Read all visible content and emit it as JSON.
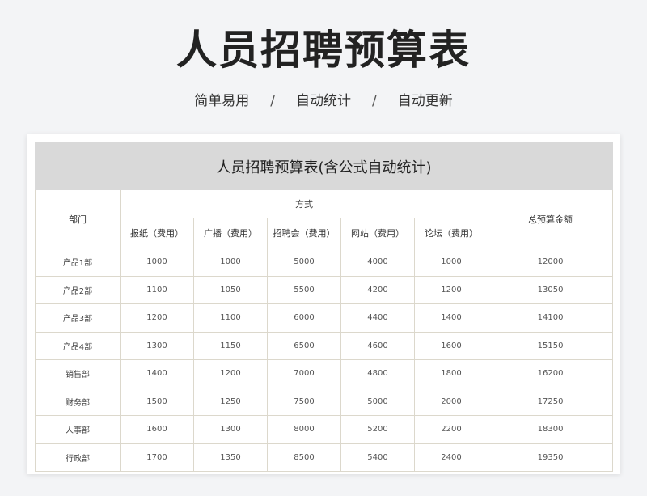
{
  "header": {
    "title": "人员招聘预算表",
    "subtitle_items": [
      "简单易用",
      "自动统计",
      "自动更新"
    ],
    "separator": "/"
  },
  "table": {
    "title": "人员招聘预算表(含公式自动统计)",
    "dept_header": "部门",
    "method_header": "方式",
    "total_header": "总预算金额",
    "method_columns": [
      "报纸（费用）",
      "广播（费用）",
      "招聘会（费用）",
      "网站（费用）",
      "论坛（费用）"
    ],
    "rows": [
      {
        "dept": "产品1部",
        "values": [
          "1000",
          "1000",
          "5000",
          "4000",
          "1000"
        ],
        "total": "12000"
      },
      {
        "dept": "产品2部",
        "values": [
          "1100",
          "1050",
          "5500",
          "4200",
          "1200"
        ],
        "total": "13050"
      },
      {
        "dept": "产品3部",
        "values": [
          "1200",
          "1100",
          "6000",
          "4400",
          "1400"
        ],
        "total": "14100"
      },
      {
        "dept": "产品4部",
        "values": [
          "1300",
          "1150",
          "6500",
          "4600",
          "1600"
        ],
        "total": "15150"
      },
      {
        "dept": "销售部",
        "values": [
          "1400",
          "1200",
          "7000",
          "4800",
          "1800"
        ],
        "total": "16200"
      },
      {
        "dept": "财务部",
        "values": [
          "1500",
          "1250",
          "7500",
          "5000",
          "2000"
        ],
        "total": "17250"
      },
      {
        "dept": "人事部",
        "values": [
          "1600",
          "1300",
          "8000",
          "5200",
          "2200"
        ],
        "total": "18300"
      },
      {
        "dept": "行政部",
        "values": [
          "1700",
          "1350",
          "8500",
          "5400",
          "2400"
        ],
        "total": "19350"
      }
    ]
  },
  "colors": {
    "background": "#f3f4f6",
    "title_bar": "#d9d9d9",
    "grid_line": "#dcd8cc"
  }
}
